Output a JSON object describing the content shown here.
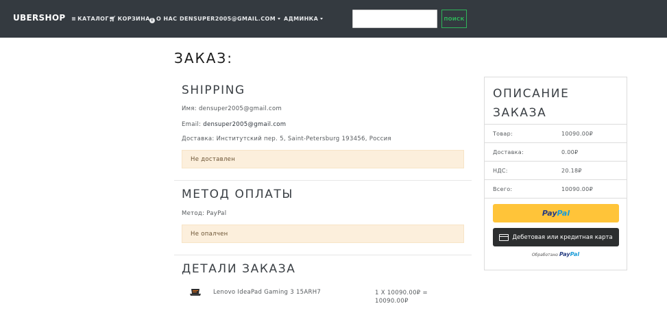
{
  "navbar": {
    "brand": "UBERSHOP",
    "catalog": "КАТАЛОГ",
    "cart": "КОРЗИНА",
    "about": "О НАС",
    "user": "DENSUPER2005@GMAIL.COM",
    "admin": "АДМИНКА",
    "search_value": "",
    "search_button": "ПОИСК"
  },
  "order": {
    "title": "ЗАКАЗ:",
    "shipping": {
      "heading": "SHIPPING",
      "name_line": "Имя: densuper2005@gmail.com",
      "email_label": "Email: ",
      "email_value": "densuper2005@gmail.com",
      "address_line": "Доставка: Институтский пер. 5, Saint-Petersburg 193456, Россия",
      "status": "Не доставлен"
    },
    "payment": {
      "heading": "МЕТОД ОПЛАТЫ",
      "method_line": "Метод: PayPal",
      "status": "Не опалчен"
    },
    "details": {
      "heading": "ДЕТАЛИ ЗАКАЗА",
      "items": [
        {
          "name": "Lenovo IdeaPad Gaming 3 15ARH7",
          "price_line1": "1 X 10090.00₽ =",
          "price_line2": "10090.00₽"
        }
      ]
    }
  },
  "summary": {
    "heading_line1": "ОПИСАНИЕ",
    "heading_line2": "ЗАКАЗА",
    "rows": [
      {
        "label": "Товар:",
        "value": "10090.00₽"
      },
      {
        "label": "Доставка:",
        "value": "0.00₽"
      },
      {
        "label": "НДС:",
        "value": "20.18₽"
      },
      {
        "label": "Всего:",
        "value": "10090.00₽"
      }
    ],
    "paypal_part1": "Pay",
    "paypal_part2": "Pal",
    "card_button": "Дебетовая или кредитная карта",
    "powered_by": "Обработано ",
    "powered_pp1": "Pay",
    "powered_pp2": "Pal"
  },
  "colors": {
    "navbar_bg": "#343a40",
    "alert_bg": "#fcefdc",
    "search_accent": "#2fb65a",
    "paypal_yellow": "#ffc439",
    "card_btn_bg": "#2c2e2f"
  }
}
